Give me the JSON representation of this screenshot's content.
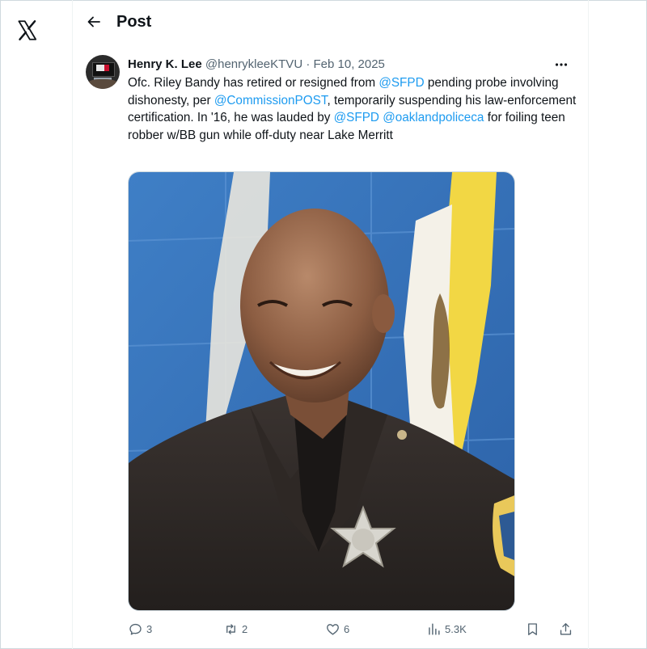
{
  "header": {
    "title": "Post"
  },
  "post": {
    "author_name": "Henry K. Lee",
    "author_handle": "@henrykleeKTVU",
    "separator": "·",
    "date": "Feb 10, 2025",
    "text": {
      "s1": "Ofc. Riley Bandy has retired or resigned from ",
      "m1": "@SFPD",
      "s2": " pending probe involving dishonesty, per ",
      "m2": "@CommissionPOST",
      "s3": ", temporarily suspending his law-enforcement certification. In '16, he was lauded by ",
      "m3": "@SFPD",
      "s4": " ",
      "m4": "@oaklandpoliceca",
      "s5": " for foiling teen robber w/BB gun while off-duty near Lake Merritt"
    }
  },
  "actions": {
    "replies": "3",
    "reposts": "2",
    "likes": "6",
    "views": "5.3K"
  },
  "colors": {
    "accent": "#1d9bf0",
    "text_primary": "#0f1419",
    "text_secondary": "#536471",
    "border": "#cfd9de"
  },
  "icons": [
    "x-logo-icon",
    "back-arrow-icon",
    "more-icon",
    "reply-icon",
    "repost-icon",
    "like-icon",
    "views-icon",
    "bookmark-icon",
    "share-icon"
  ]
}
